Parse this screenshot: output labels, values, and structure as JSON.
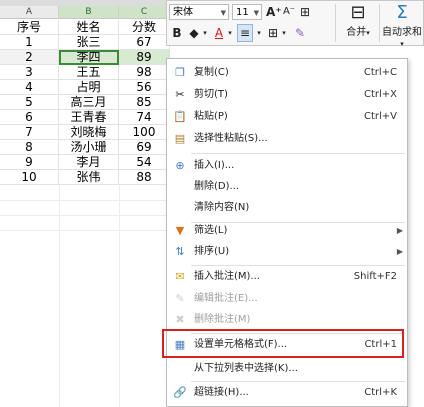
{
  "sheet": {
    "columns": [
      "A",
      "B",
      "C"
    ],
    "header": [
      "序号",
      "姓名",
      "分数"
    ],
    "rows": [
      [
        "1",
        "张三",
        "67"
      ],
      [
        "2",
        "李四",
        "89"
      ],
      [
        "3",
        "王五",
        "98"
      ],
      [
        "4",
        "占明",
        "56"
      ],
      [
        "5",
        "高三月",
        "85"
      ],
      [
        "6",
        "王青春",
        "74"
      ],
      [
        "7",
        "刘晓梅",
        "100"
      ],
      [
        "8",
        "汤小珊",
        "69"
      ],
      [
        "9",
        "李月",
        "54"
      ],
      [
        "10",
        "张伟",
        "88"
      ]
    ],
    "selected_row": 1
  },
  "toolbar": {
    "font": "宋体",
    "size": "11",
    "grow_font": "A⁺",
    "shrink_font": "A⁻",
    "bold": "B",
    "font_color": "A",
    "merge_label": "合并",
    "autosum_label": "自动求和"
  },
  "menu": {
    "items": [
      {
        "label": "复制(C)",
        "shortcut": "Ctrl+C",
        "icon": "copy-icon"
      },
      {
        "label": "剪切(T)",
        "shortcut": "Ctrl+X",
        "icon": "scissors-icon"
      },
      {
        "label": "粘贴(P)",
        "shortcut": "Ctrl+V",
        "icon": "paste-icon"
      },
      {
        "label": "选择性粘贴(S)...",
        "shortcut": "",
        "icon": "paste-special-icon"
      },
      {
        "label": "插入(I)...",
        "shortcut": "",
        "icon": "insert-icon"
      },
      {
        "label": "删除(D)...",
        "shortcut": "",
        "icon": ""
      },
      {
        "label": "清除内容(N)",
        "shortcut": "",
        "icon": ""
      },
      {
        "label": "筛选(L)",
        "shortcut": "",
        "icon": "filter-icon"
      },
      {
        "label": "排序(U)",
        "shortcut": "",
        "icon": "sort-icon"
      },
      {
        "label": "插入批注(M)...",
        "shortcut": "Shift+F2",
        "icon": "comment-icon"
      },
      {
        "label": "编辑批注(E)...",
        "shortcut": "",
        "icon": "edit-comment-icon"
      },
      {
        "label": "删除批注(M)",
        "shortcut": "",
        "icon": "delete-comment-icon"
      },
      {
        "label": "设置单元格格式(F)...",
        "shortcut": "Ctrl+1",
        "icon": "format-cells-icon"
      },
      {
        "label": "从下拉列表中选择(K)...",
        "shortcut": "",
        "icon": ""
      },
      {
        "label": "超链接(H)...",
        "shortcut": "Ctrl+K",
        "icon": "hyperlink-icon"
      }
    ]
  },
  "colors": {
    "selection": "#d9ead3",
    "selection_border": "#3a8a3a",
    "highlight": "#d9201f"
  }
}
